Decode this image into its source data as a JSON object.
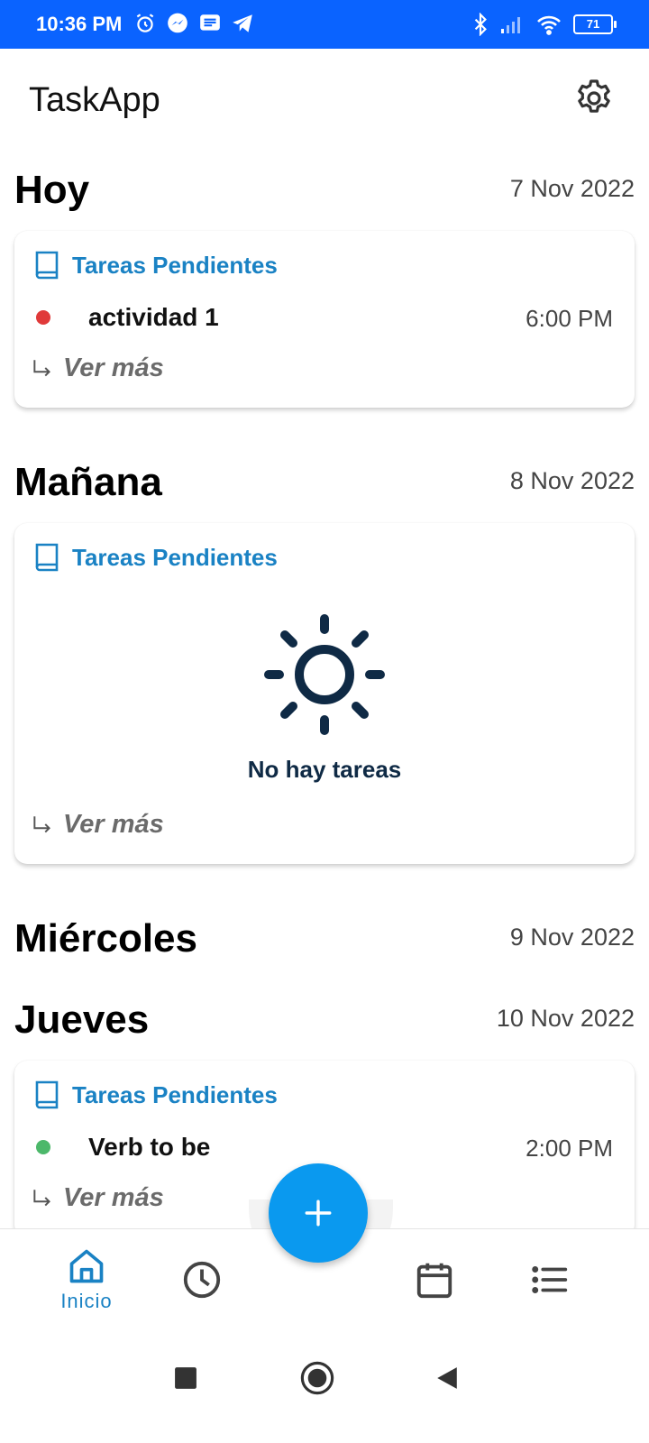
{
  "status_bar": {
    "time": "10:36 PM",
    "battery": "71",
    "left_icons": [
      "alarm-icon",
      "messenger-icon",
      "message-icon",
      "telegram-icon"
    ],
    "right_icons": [
      "bluetooth-icon",
      "signal-icon",
      "wifi-icon",
      "battery-icon"
    ]
  },
  "header": {
    "title": "TaskApp",
    "settings_icon": "gear-icon"
  },
  "days": [
    {
      "name": "Hoy",
      "date": "7 Nov 2022",
      "card": {
        "title": "Tareas Pendientes",
        "tasks": [
          {
            "name": "actividad 1",
            "time": "6:00 PM",
            "dot_color": "#e03a3a"
          }
        ],
        "more": "Ver más"
      }
    },
    {
      "name": "Mañana",
      "date": "8 Nov 2022",
      "card": {
        "title": "Tareas Pendientes",
        "empty": "No hay tareas",
        "more": "Ver más"
      }
    },
    {
      "name": "Miércoles",
      "date": "9 Nov 2022"
    },
    {
      "name": "Jueves",
      "date": "10 Nov 2022",
      "card": {
        "title": "Tareas Pendientes",
        "tasks": [
          {
            "name": "Verb to be",
            "time": "2:00 PM",
            "dot_color": "#4cb86a"
          }
        ],
        "more": "Ver más"
      }
    }
  ],
  "bottom_nav": {
    "items": [
      {
        "label": "Inicio",
        "icon": "home-icon",
        "active": true
      },
      {
        "label": "",
        "icon": "clock-icon"
      },
      {
        "label": "",
        "icon": "calendar-icon"
      },
      {
        "label": "",
        "icon": "list-icon"
      }
    ],
    "fab_icon": "plus-icon"
  },
  "colors": {
    "accent": "#1a82c4",
    "fab": "#0a99ef",
    "status_bar": "#0a63ff",
    "dark_icon": "#0f2a45"
  }
}
